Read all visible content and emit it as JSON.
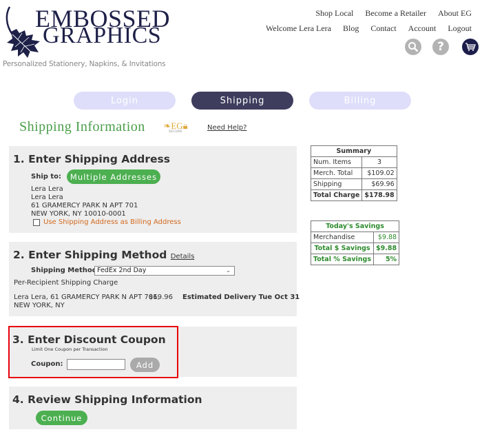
{
  "header": {
    "logo_line1": "EMBOSSED",
    "logo_line2": "GRAPHICS",
    "tagline": "Personalized Stationery, Napkins, & Invitations",
    "nav_row1": [
      "Shop Local",
      "Become a Retailer",
      "About EG"
    ],
    "nav_row2": [
      "Welcome Lera Lera",
      "Blog",
      "Contact",
      "Account",
      "Logout"
    ],
    "icons": [
      "search-icon",
      "help-icon",
      "cart-icon"
    ],
    "help_glyph": "?"
  },
  "steps": {
    "login": "Login",
    "shipping": "Shipping",
    "billing": "Billing",
    "active": "Shipping"
  },
  "page": {
    "title": "Shipping Information",
    "secure_badge_logo": "EG",
    "secure_badge_text": "SECURE",
    "need_help": "Need Help?"
  },
  "section1": {
    "heading": "1. Enter Shipping Address",
    "ship_to_label": "Ship to:",
    "multiple_addresses_button": "Multiple Addresses",
    "address_lines": [
      "Lera Lera",
      "Lera Lera",
      "61 GRAMERCY PARK N APT 701",
      "NEW YORK, NY 10010-0001"
    ],
    "billing_checkbox_label": "Use Shipping Address as Billing Address",
    "billing_checkbox_checked": false
  },
  "section2": {
    "heading": "2. Enter Shipping Method",
    "details_link": "Details",
    "method_label": "Shipping Method:",
    "method_value": "FedEx 2nd Day",
    "per_recipient_label": "Per-Recipient Shipping Charge",
    "recipient_line1": "Lera Lera, 61 GRAMERCY PARK N APT 701,",
    "recipient_line2": "NEW YORK, NY",
    "recipient_charge": "$69.96",
    "estimated_delivery": "Estimated Delivery Tue Oct 31"
  },
  "section3": {
    "heading": "3. Enter Discount Coupon",
    "limit_note": "Limit One Coupon per Transaction",
    "coupon_label": "Coupon:",
    "coupon_value": "",
    "add_button": "Add"
  },
  "section4": {
    "heading": "4. Review Shipping Information",
    "continue_button": "Continue"
  },
  "summary": {
    "title": "Summary",
    "rows": [
      {
        "label": "Num. Items",
        "value": "3"
      },
      {
        "label": "Merch. Total",
        "value": "$109.02"
      },
      {
        "label": "Shipping",
        "value": "$69.96"
      }
    ],
    "total_label": "Total Charge",
    "total_value": "$178.98"
  },
  "savings": {
    "title": "Today's Savings",
    "merch_label": "Merchandise",
    "merch_value": "$9.88",
    "total_dollar_label": "Total $ Savings",
    "total_dollar_value": "$9.88",
    "total_pct_label": "Total % Savings",
    "total_pct_value": "5%"
  },
  "colors": {
    "brand_navy": "#1e2048",
    "accent_green": "#4caf50",
    "title_green": "#4a9e4a",
    "active_step": "#3e3d5e",
    "inactive_step": "#dedefa",
    "highlight_red": "#e8000b"
  }
}
